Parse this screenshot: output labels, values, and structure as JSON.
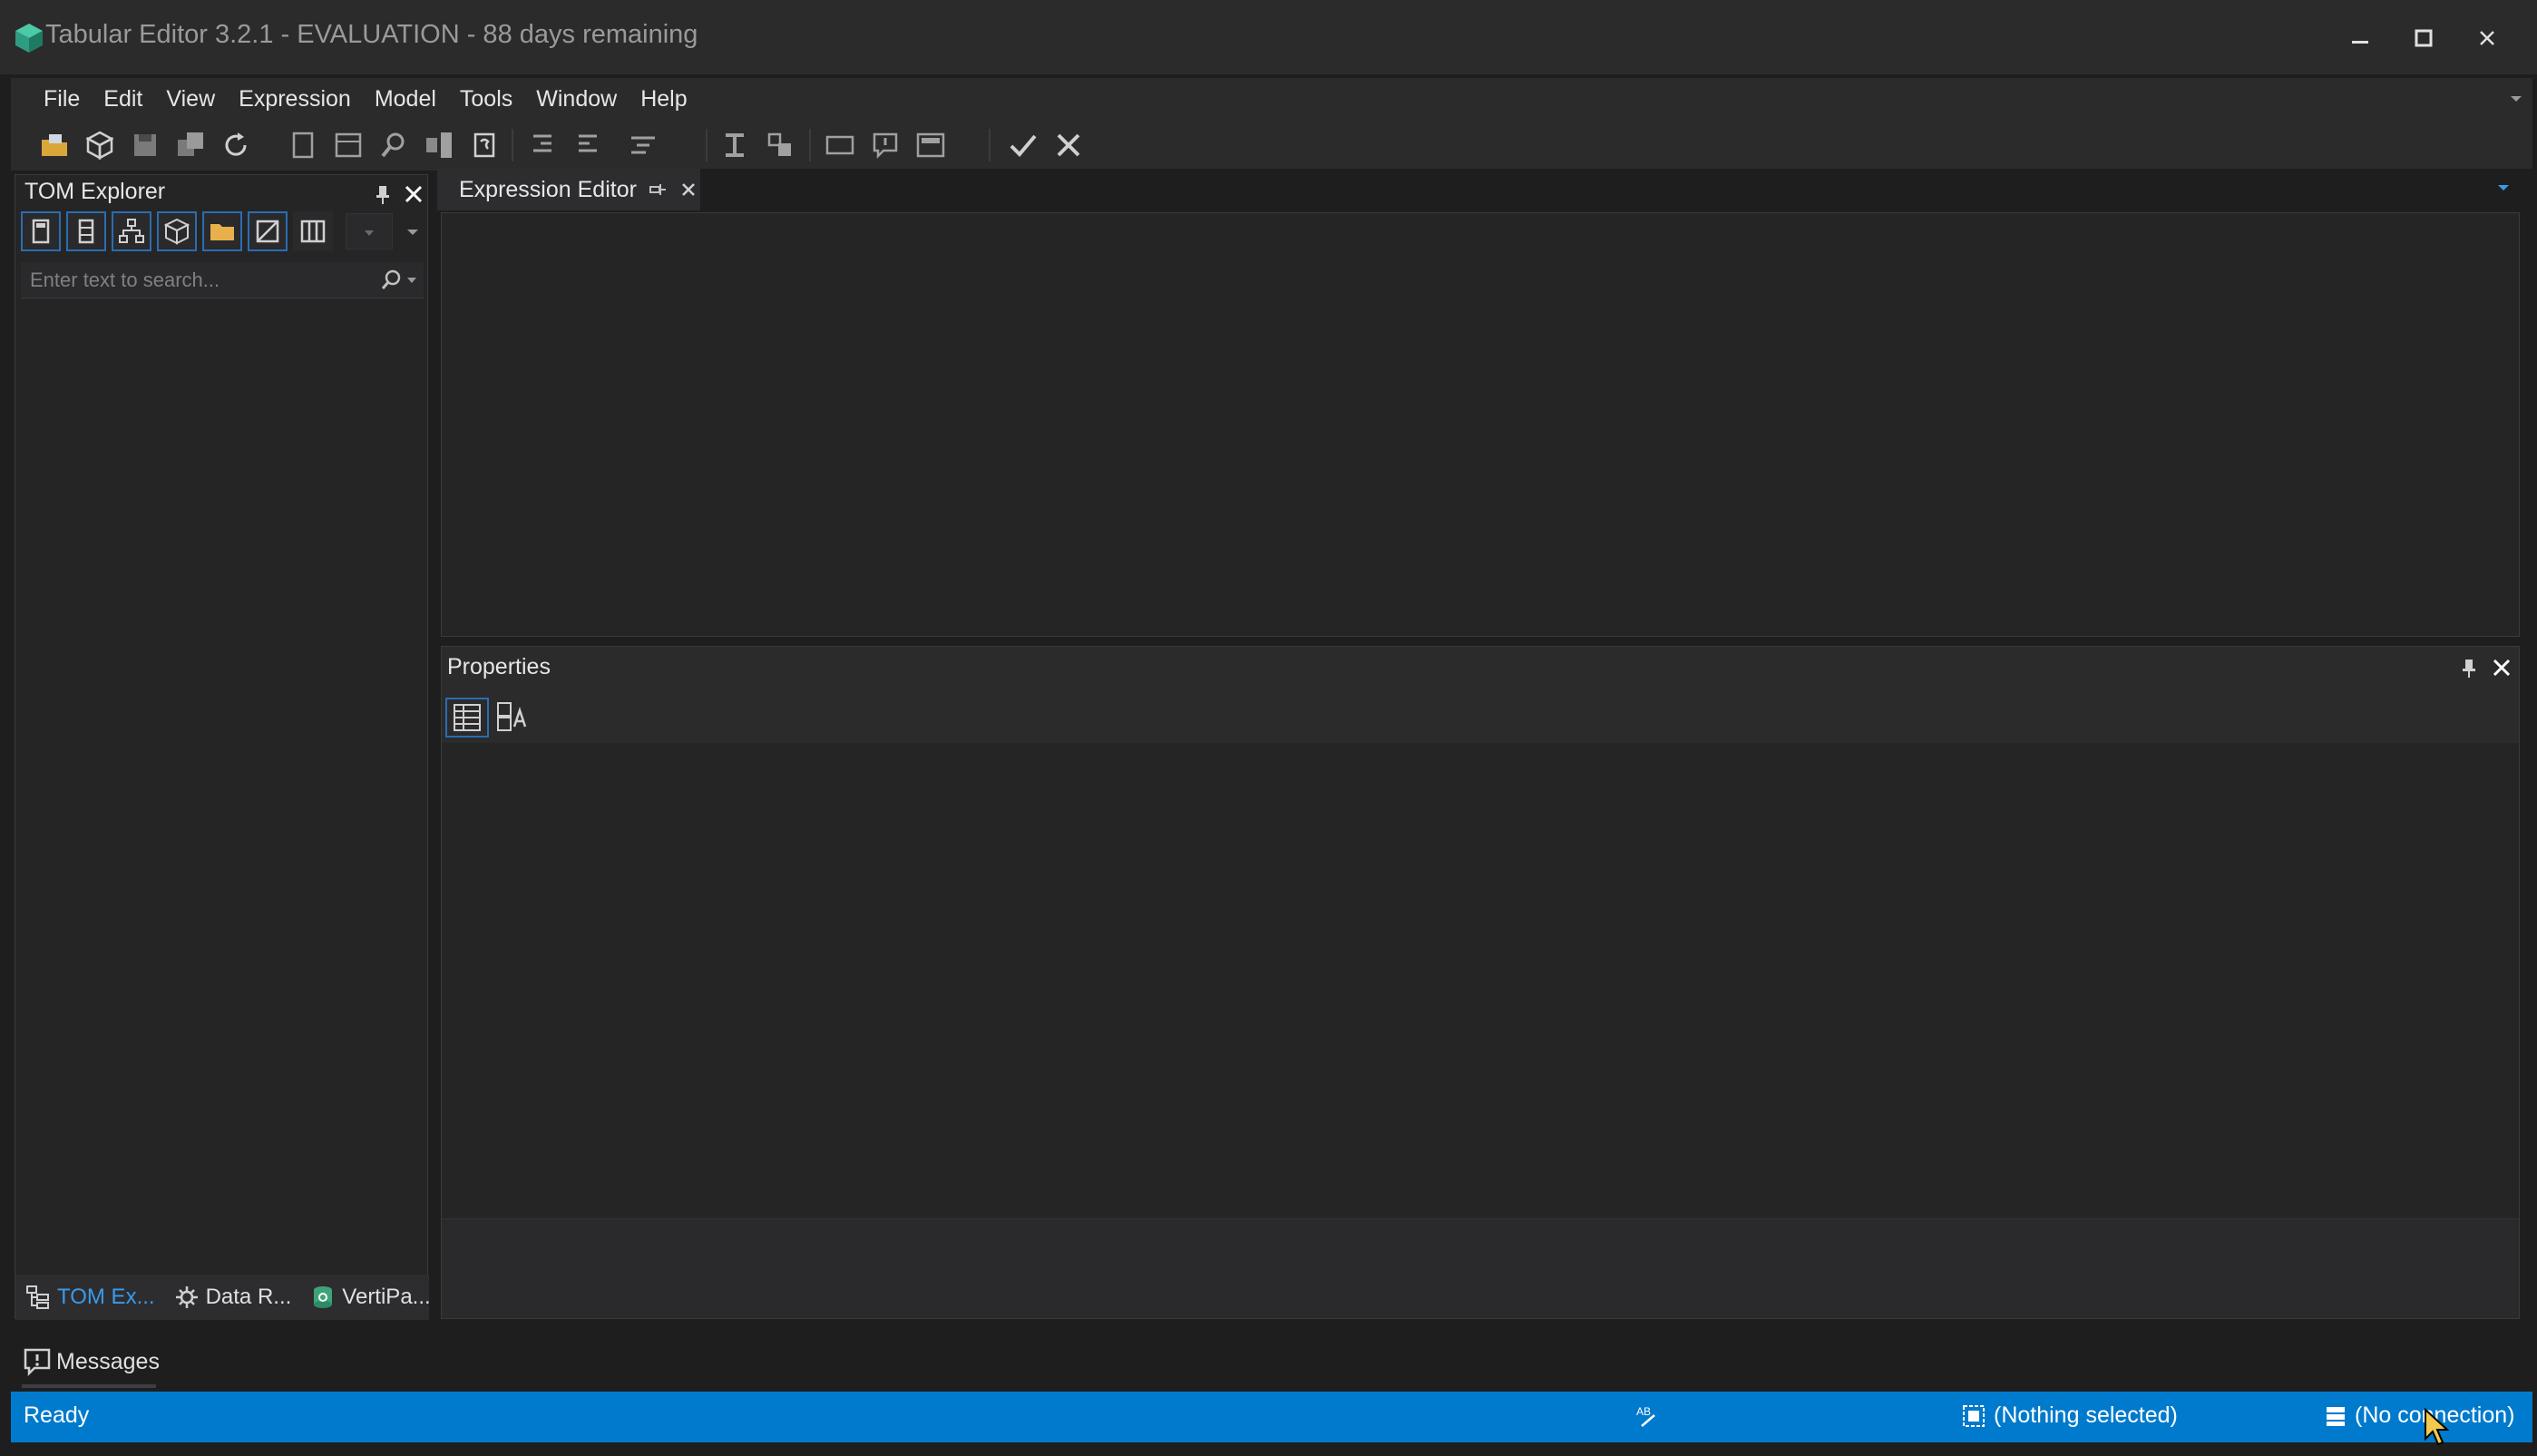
{
  "window": {
    "title": "Tabular Editor 3.2.1 - EVALUATION - 88 days remaining",
    "logo_icon": "tabular-editor-cube-icon",
    "controls": [
      "minimize-icon",
      "maximize-icon",
      "close-icon"
    ]
  },
  "menu": [
    "File",
    "Edit",
    "View",
    "Expression",
    "Model",
    "Tools",
    "Window",
    "Help"
  ],
  "toolbar": {
    "icons": [
      "open-icon",
      "open-model-icon",
      "save-icon",
      "save-all-icon",
      "refresh-icon",
      "new-document-icon",
      "new-table-icon",
      "find-icon",
      "deploy-icon",
      "script-icon",
      "indent-icon",
      "outdent-icon",
      "align-icon",
      "format-icon",
      "toggle-icon",
      "comment-icon",
      "uncomment-icon",
      "layout-icon",
      "accept-icon",
      "cancel-icon"
    ]
  },
  "tom_explorer": {
    "title": "TOM Explorer",
    "search_placeholder": "Enter text to search...",
    "filter_icons": [
      "calculator-icon",
      "column-list-icon",
      "hierarchy-icon",
      "model-cube-icon",
      "folder-icon",
      "hidden-objects-icon",
      "columns-icon"
    ],
    "bottom_tabs": [
      {
        "label": "TOM Ex...",
        "icon": "tom-explorer-icon",
        "active": true
      },
      {
        "label": "Data R...",
        "icon": "data-refresh-icon",
        "active": false
      },
      {
        "label": "VertiPa...",
        "icon": "vertipaq-icon",
        "active": false
      }
    ]
  },
  "expression_editor": {
    "tab_label": "Expression Editor"
  },
  "properties": {
    "title": "Properties",
    "toolbar_icons": [
      "categorized-icon",
      "alphabetical-icon"
    ]
  },
  "messages": {
    "tab_label": "Messages"
  },
  "statusbar": {
    "status": "Ready",
    "selection": "(Nothing selected)",
    "connection": "(No connection)"
  },
  "colors": {
    "background": "#1e1e1e",
    "panel": "#252526",
    "chrome": "#2b2b2b",
    "accent": "#007acc",
    "active_tab_text": "#3b9ae8"
  }
}
